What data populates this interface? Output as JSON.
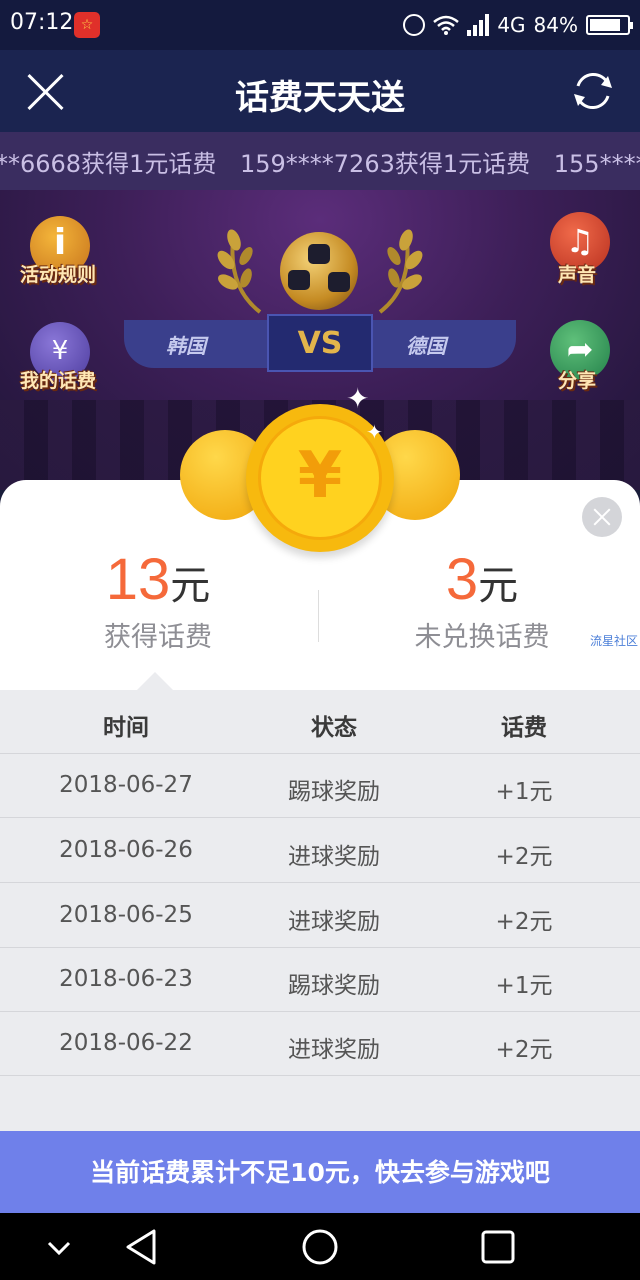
{
  "status_bar": {
    "time": "07:12",
    "network": "4G",
    "battery": "84%",
    "battery_level": 0.84
  },
  "header": {
    "title": "话费天天送",
    "close_icon": "close-icon",
    "refresh_icon": "refresh-icon"
  },
  "ticker": {
    "text": "**6668获得1元话费   159****7263获得1元话费   155****0"
  },
  "game": {
    "rules_label": "活动规则",
    "my_fee_label": "我的话费",
    "sound_label": "声音",
    "share_label": "分享",
    "team_left": "韩国",
    "vs": "VS",
    "team_right": "德国",
    "coin_symbol": "¥"
  },
  "summary": {
    "earned_value": "13",
    "earned_unit": "元",
    "earned_label": "获得话费",
    "unredeemed_value": "3",
    "unredeemed_unit": "元",
    "unredeemed_label": "未兑换话费",
    "watermark": "流星社区"
  },
  "table": {
    "headers": [
      "时间",
      "状态",
      "话费"
    ],
    "rows": [
      {
        "date": "2018-06-27",
        "status": "踢球奖励",
        "amount": "+1元"
      },
      {
        "date": "2018-06-26",
        "status": "进球奖励",
        "amount": "+2元"
      },
      {
        "date": "2018-06-25",
        "status": "进球奖励",
        "amount": "+2元"
      },
      {
        "date": "2018-06-23",
        "status": "踢球奖励",
        "amount": "+1元"
      },
      {
        "date": "2018-06-22",
        "status": "进球奖励",
        "amount": "+2元"
      }
    ]
  },
  "banner": {
    "text": "当前话费累计不足10元，快去参与游戏吧"
  },
  "colors": {
    "accent_orange": "#f5693a",
    "banner_blue": "#6f80ea",
    "header_navy": "#1b2450"
  }
}
